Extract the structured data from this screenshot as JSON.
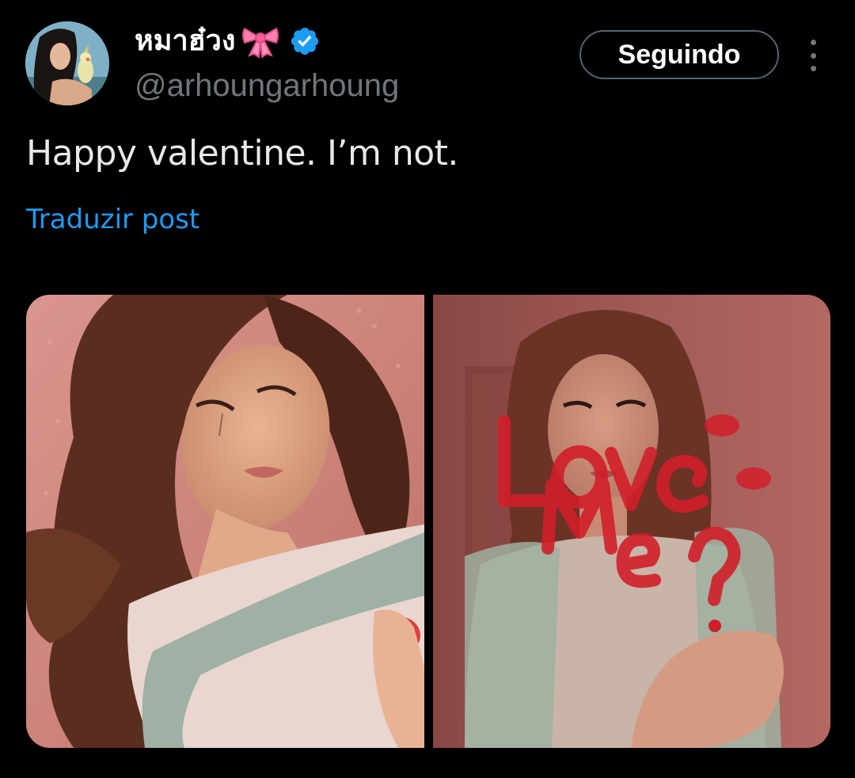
{
  "post": {
    "author": {
      "display_name": "หมาฮ๋วง",
      "name_emoji_icon": "ribbon-icon",
      "verified_icon": "verified-badge-icon",
      "handle": "@arhoungarhoung"
    },
    "follow_button_label": "Seguindo",
    "more_icon": "more-options-icon",
    "text": "Happy valentine. I’m not.",
    "translate_link": "Traduzir post",
    "media": [
      {
        "kind": "photo",
        "overlay_text": ""
      },
      {
        "kind": "photo",
        "overlay_text": "Love Me?"
      }
    ]
  },
  "colors": {
    "background": "#000000",
    "text_primary": "#e7e9ea",
    "text_secondary": "#71767b",
    "link": "#1d9bf0",
    "verified": "#1d9bf0",
    "button_border": "#536471"
  }
}
